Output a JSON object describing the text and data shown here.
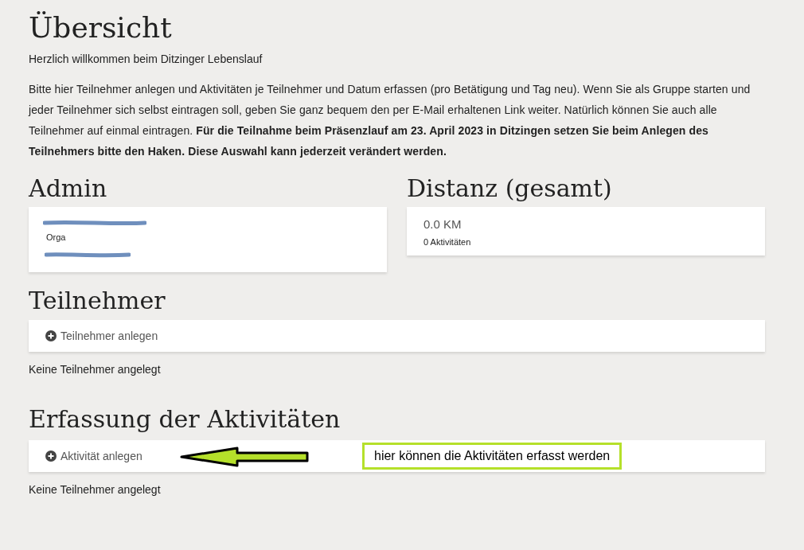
{
  "title": "Übersicht",
  "welcome": "Herzlich willkommen beim Ditzinger Lebenslauf",
  "intro": "Bitte hier Teilnehmer anlegen und Aktivitäten je Teilnehmer und Datum erfassen (pro Betätigung und Tag neu). Wenn Sie als Gruppe starten und jeder Teilnehmer sich selbst eintragen soll, geben Sie ganz bequem den per E-Mail erhaltenen Link weiter. Natürlich können Sie auch alle Teilnehmer auf einmal eintragen. **Für die Teilnahme beim Präsenzlauf am 23. April 2023 in Ditzingen setzen Sie beim Anlegen des Teilnehmers bitte den Haken. Diese Auswahl kann jederzeit verändert werden.**",
  "admin": {
    "heading": "Admin",
    "role": "Orga"
  },
  "distance": {
    "heading": "Distanz (gesamt)",
    "total": "0.0 KM",
    "activities": "0 Aktivitäten"
  },
  "participants": {
    "heading": "Teilnehmer",
    "add_button": "Teilnehmer anlegen",
    "empty": "Keine Teilnehmer angelegt"
  },
  "activities": {
    "heading": "Erfassung der Aktivitäten",
    "add_button": "Aktivität anlegen",
    "empty": "Keine Teilnehmer angelegt",
    "annotation": "hier können die Aktivitäten erfasst werden"
  }
}
